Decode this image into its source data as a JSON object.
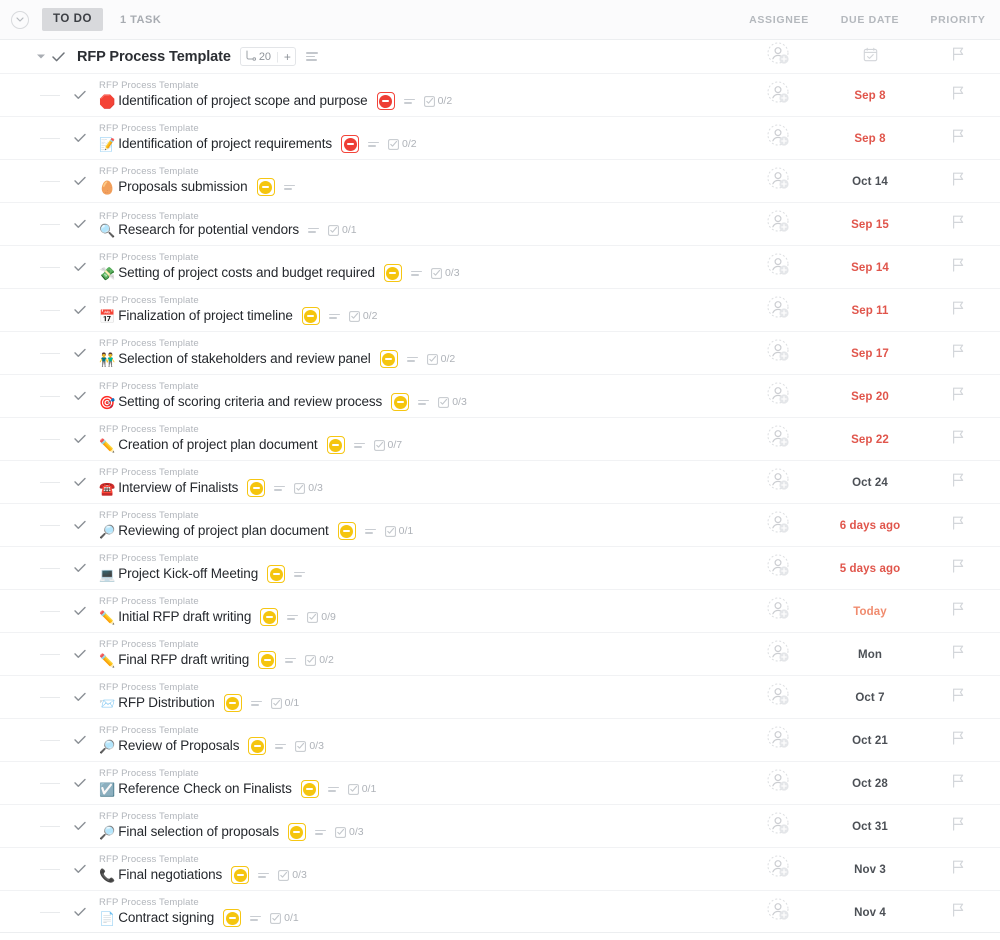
{
  "header": {
    "collapse_icon": "chevron-down-icon",
    "status_label": "TO DO",
    "task_count": "1 TASK",
    "columns": {
      "assignee": "ASSIGNEE",
      "due_date": "DUE DATE",
      "priority": "PRIORITY"
    }
  },
  "parent_task": {
    "caret_icon": "caret-down-icon",
    "check_icon": "check-icon",
    "title": "RFP Process Template",
    "subtask_icon": "subtask-icon",
    "subtask_count": "20",
    "add_subtask_label": "+",
    "description_icon": "description-icon",
    "assignee_icon": "add-assignee-icon",
    "due_date_icon": "calendar-icon",
    "priority_icon": "flag-icon"
  },
  "breadcrumb_label": "RFP Process Template",
  "tasks": [
    {
      "emoji": "🛑",
      "emoji_name": "stop-sign-emoji",
      "name": "Identification of project scope and purpose",
      "status": "red",
      "has_description": true,
      "checklist": "0/2",
      "due": "Sep 8",
      "due_state": "overdue"
    },
    {
      "emoji": "📝",
      "emoji_name": "memo-emoji",
      "name": "Identification of project requirements",
      "status": "red",
      "has_description": true,
      "checklist": "0/2",
      "due": "Sep 8",
      "due_state": "overdue"
    },
    {
      "emoji": "🥚",
      "emoji_name": "egg-emoji",
      "name": "Proposals submission",
      "status": "yellow",
      "has_description": true,
      "checklist": "",
      "due": "Oct 14",
      "due_state": "normal"
    },
    {
      "emoji": "🔍",
      "emoji_name": "magnifier-emoji",
      "name": "Research for potential vendors",
      "status": "",
      "has_description": true,
      "checklist": "0/1",
      "due": "Sep 15",
      "due_state": "overdue"
    },
    {
      "emoji": "💸",
      "emoji_name": "money-wings-emoji",
      "name": "Setting of project costs and budget required",
      "status": "yellow",
      "has_description": true,
      "checklist": "0/3",
      "due": "Sep 14",
      "due_state": "overdue"
    },
    {
      "emoji": "📅",
      "emoji_name": "calendar-emoji",
      "name": "Finalization of project timeline",
      "status": "yellow",
      "has_description": true,
      "checklist": "0/2",
      "due": "Sep 11",
      "due_state": "overdue"
    },
    {
      "emoji": "👬",
      "emoji_name": "people-emoji",
      "name": "Selection of stakeholders and review panel",
      "status": "yellow",
      "has_description": true,
      "checklist": "0/2",
      "due": "Sep 17",
      "due_state": "overdue"
    },
    {
      "emoji": "🎯",
      "emoji_name": "dart-emoji",
      "name": "Setting of scoring criteria and review process",
      "status": "yellow",
      "has_description": true,
      "checklist": "0/3",
      "due": "Sep 20",
      "due_state": "overdue"
    },
    {
      "emoji": "✏️",
      "emoji_name": "pencil-emoji",
      "name": "Creation of project plan document",
      "status": "yellow",
      "has_description": true,
      "checklist": "0/7",
      "due": "Sep 22",
      "due_state": "overdue"
    },
    {
      "emoji": "☎️",
      "emoji_name": "telephone-emoji",
      "name": "Interview of Finalists",
      "status": "yellow",
      "has_description": true,
      "checklist": "0/3",
      "due": "Oct 24",
      "due_state": "normal"
    },
    {
      "emoji": "🔎",
      "emoji_name": "magnifier-right-emoji",
      "name": "Reviewing of project plan document",
      "status": "yellow",
      "has_description": true,
      "checklist": "0/1",
      "due": "6 days ago",
      "due_state": "overdue"
    },
    {
      "emoji": "💻",
      "emoji_name": "laptop-emoji",
      "name": "Project Kick-off Meeting",
      "status": "yellow",
      "has_description": true,
      "checklist": "",
      "due": "5 days ago",
      "due_state": "overdue"
    },
    {
      "emoji": "✏️",
      "emoji_name": "pencil-emoji",
      "name": "Initial RFP draft writing",
      "status": "yellow",
      "has_description": true,
      "checklist": "0/9",
      "due": "Today",
      "due_state": "today"
    },
    {
      "emoji": "✏️",
      "emoji_name": "pencil-emoji",
      "name": "Final RFP draft writing",
      "status": "yellow",
      "has_description": true,
      "checklist": "0/2",
      "due": "Mon",
      "due_state": "normal"
    },
    {
      "emoji": "📨",
      "emoji_name": "incoming-envelope-emoji",
      "name": "RFP Distribution",
      "status": "yellow",
      "has_description": true,
      "checklist": "0/1",
      "due": "Oct 7",
      "due_state": "normal"
    },
    {
      "emoji": "🔎",
      "emoji_name": "magnifier-right-emoji",
      "name": "Review of Proposals",
      "status": "yellow",
      "has_description": true,
      "checklist": "0/3",
      "due": "Oct 21",
      "due_state": "normal"
    },
    {
      "emoji": "☑️",
      "emoji_name": "ballot-check-emoji",
      "name": "Reference Check on Finalists",
      "status": "yellow",
      "has_description": true,
      "checklist": "0/1",
      "due": "Oct 28",
      "due_state": "normal"
    },
    {
      "emoji": "🔎",
      "emoji_name": "magnifier-right-emoji",
      "name": "Final selection of proposals",
      "status": "yellow",
      "has_description": true,
      "checklist": "0/3",
      "due": "Oct 31",
      "due_state": "normal"
    },
    {
      "emoji": "📞",
      "emoji_name": "telephone-receiver-emoji",
      "name": "Final negotiations",
      "status": "yellow",
      "has_description": true,
      "checklist": "0/3",
      "due": "Nov 3",
      "due_state": "normal"
    },
    {
      "emoji": "📄",
      "emoji_name": "page-emoji",
      "name": "Contract signing",
      "status": "yellow",
      "has_description": true,
      "checklist": "0/1",
      "due": "Nov 4",
      "due_state": "normal"
    }
  ],
  "colors": {
    "status_red": "#ee3d34",
    "status_yellow": "#f5c50e",
    "due_overdue": "#e0554b",
    "due_today": "#f08b6e",
    "due_normal": "#4c5056"
  }
}
